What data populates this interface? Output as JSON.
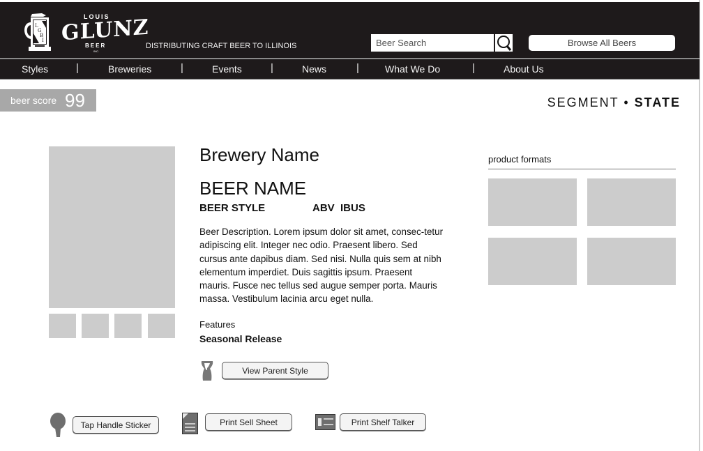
{
  "header": {
    "logo": {
      "top_text": "LOUIS",
      "main_text": "GLUNZ",
      "sub_text": "BEER",
      "inc_text": "INC.",
      "mug_monogram": "LGBI"
    },
    "tagline": "DISTRIBUTING CRAFT BEER TO ILLINOIS",
    "search": {
      "placeholder": "Beer Search",
      "value": "",
      "icon": "search-icon"
    },
    "browse_label": "Browse All Beers"
  },
  "nav": {
    "items": [
      {
        "label": "Styles"
      },
      {
        "label": "Breweries"
      },
      {
        "label": "Events"
      },
      {
        "label": "News"
      },
      {
        "label": "What We Do"
      },
      {
        "label": "About Us"
      }
    ],
    "separator": "|"
  },
  "score": {
    "label": "beer score",
    "value": "99"
  },
  "segment": {
    "segment": "SEGMENT",
    "dot": "•",
    "state": "STATE"
  },
  "beer": {
    "brewery": "Brewery Name",
    "name": "BEER NAME",
    "style": "BEER STYLE",
    "abv": "ABV",
    "ibus": "IBUS",
    "description": "Beer Description. Lorem ipsum dolor sit amet, consec-tetur adipiscing elit. Integer nec odio. Praesent libero. Sed cursus ante dapibus diam. Sed nisi. Nulla quis sem at nibh elementum imperdiet. Duis sagittis ipsum. Praesent mauris. Fusce nec tellus sed augue semper porta. Mauris massa. Vestibulum lacinia arcu eget nulla.",
    "features_label": "Features",
    "features_value": "Seasonal Release",
    "parent_style_label": "View Parent Style"
  },
  "product_formats": {
    "title": "product formats",
    "count": 4
  },
  "gallery": {
    "thumbnail_count": 4
  },
  "actions": {
    "tap_handle": {
      "label": "Tap Handle Sticker",
      "icon": "tap-handle-icon"
    },
    "sell_sheet": {
      "label": "Print Sell Sheet",
      "icon": "document-icon"
    },
    "shelf_talker": {
      "label": "Print Shelf Talker",
      "icon": "shelf-talker-icon"
    }
  },
  "colors": {
    "header_bg": "#1e1a1b",
    "placeholder_gray": "#cccccc",
    "score_bg": "#a8a8a8",
    "icon_gray": "#6e6e6e"
  }
}
